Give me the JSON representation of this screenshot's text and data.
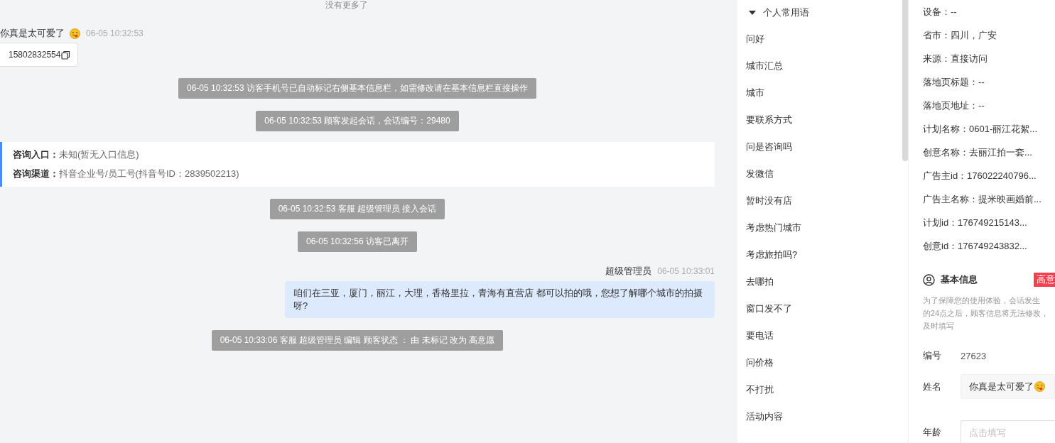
{
  "chat": {
    "no_more": "没有更多了",
    "messages": [
      {
        "kind": "customer",
        "sender": "你真是太可爱了",
        "time": "06-05 10:32:53",
        "text": "15802832554"
      },
      {
        "kind": "system",
        "text": "06-05 10:32:53 访客手机号已自动标记右侧基本信息栏，如需修改请在基本信息栏直接操作"
      },
      {
        "kind": "system",
        "text": "06-05 10:32:53 顾客发起会话，会话编号：29480"
      },
      {
        "kind": "info",
        "rows": [
          {
            "label": "咨询入口：",
            "value": "未知(暂无入口信息)"
          },
          {
            "label": "咨询渠道：",
            "value": "抖音企业号/员工号(抖音号ID：2839502213)"
          }
        ]
      },
      {
        "kind": "system",
        "text": "06-05 10:32:53 客服 超级管理员 接入会话"
      },
      {
        "kind": "system",
        "text": "06-05 10:32:56 访客已离开"
      },
      {
        "kind": "agent",
        "sender": "超级管理员",
        "time": "06-05 10:33:01",
        "text": "咱们在三亚，厦门，丽江，大理，香格里拉，青海有直营店 都可以拍的哦，您想了解哪个城市的拍摄呀?"
      },
      {
        "kind": "system",
        "text": "06-05 10:33:06 客服 超级管理员 编辑 顾客状态 ： 由 未标记 改为 高意愿"
      }
    ]
  },
  "phrases": {
    "title": "个人常用语",
    "expanded": true,
    "items": [
      "问好",
      "城市汇总",
      "城市",
      "要联系方式",
      "问是咨询吗",
      "发微信",
      "暂时没有店",
      "考虑热门城市",
      "考虑旅拍吗?",
      "去哪拍",
      "窗口发不了",
      "要电话",
      "问价格",
      "不打扰",
      "活动内容"
    ]
  },
  "visitor_info": [
    "设备：--",
    "省市：四川，广安",
    "来源：直接访问",
    "落地页标题：--",
    "落地页地址：--",
    "计划名称：0601-丽江花絮...",
    "创意名称：去丽江拍一套...",
    "广告主id：176022240796...",
    "广告主名称：提米映画婚前...",
    "计划id：176749215143...",
    "创意id：176749243832..."
  ],
  "basic_info": {
    "title": "基本信息",
    "status_tag": "高意",
    "notice": [
      "为了保障您的使用体验，会话发生",
      "的24点之后，顾客信息将无法修改，",
      "及时填写"
    ],
    "fields": [
      {
        "kind": "text",
        "label": "编号",
        "value": "27623"
      },
      {
        "kind": "filled",
        "label": "姓名",
        "value": "你真是太可爱了"
      },
      {
        "kind": "input",
        "label": "年龄",
        "placeholder": "点击填写"
      }
    ]
  }
}
